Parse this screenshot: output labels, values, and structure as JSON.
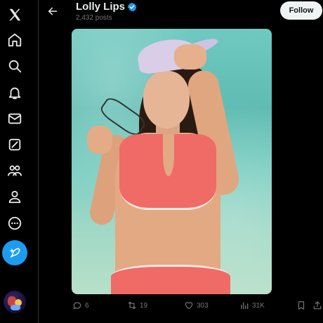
{
  "nav": {
    "items": [
      {
        "name": "x-logo-icon"
      },
      {
        "name": "home-icon"
      },
      {
        "name": "search-icon"
      },
      {
        "name": "notifications-icon"
      },
      {
        "name": "messages-icon"
      },
      {
        "name": "grok-icon"
      },
      {
        "name": "communities-icon"
      },
      {
        "name": "profile-icon"
      },
      {
        "name": "more-icon"
      }
    ],
    "compose_icon": "feather-plus-icon",
    "accent": "#1d9bf0"
  },
  "header": {
    "title": "Lolly Lips",
    "post_count": "2,432 posts",
    "follow_label": "Follow"
  },
  "actions": {
    "replies": "6",
    "reposts": "19",
    "likes": "303",
    "views": "31K"
  },
  "colors": {
    "background": "#000000",
    "muted": "#71767b",
    "verified": "#1d9bf0",
    "follow_bg": "#eff3f4"
  }
}
